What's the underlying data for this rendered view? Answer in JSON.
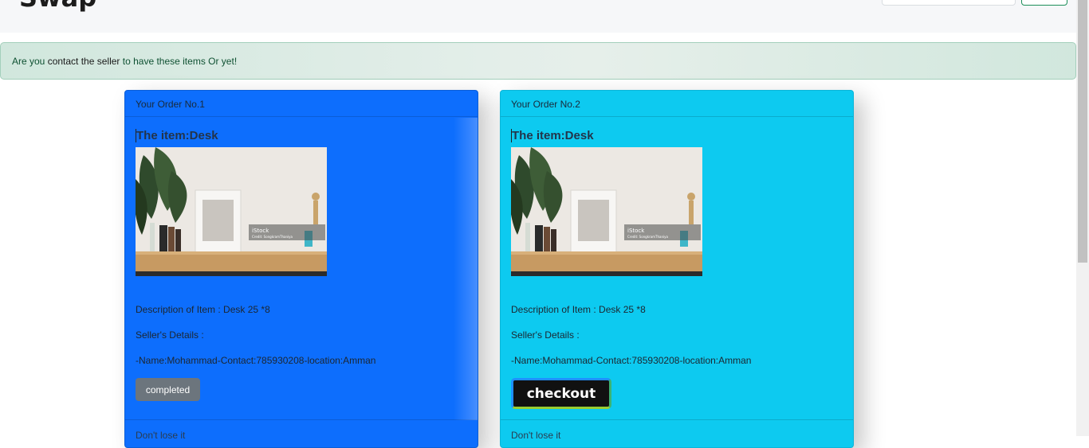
{
  "header": {
    "brand": "Swap"
  },
  "alert": {
    "prefix": "Are you ",
    "highlight": "contact the seller",
    "suffix": " to have these items Or yet!"
  },
  "orders": [
    {
      "header": "Your Order No.1",
      "title": "The item:Desk",
      "description": "Description of Item : Desk 25 *8",
      "seller_label": "Seller's Details :",
      "seller_details": "-Name:Mohammad-Contact:785930208-location:Amman",
      "button_label": "completed",
      "footer": "Don't lose it",
      "image_watermark": "iStock",
      "image_credit": "Credit: SongkramThaniya"
    },
    {
      "header": "Your Order No.2",
      "title": "The item:Desk",
      "description": "Description of Item : Desk 25 *8",
      "seller_label": "Seller's Details :",
      "seller_details": "-Name:Mohammad-Contact:785930208-location:Amman",
      "button_label": "checkout",
      "footer": "Don't lose it",
      "image_watermark": "iStock",
      "image_credit": "Credit: SongkramThaniya"
    }
  ],
  "colors": {
    "card1": "#0d6efd",
    "card2": "#0dcaf0",
    "alert_bg": "#d1e7dd"
  }
}
